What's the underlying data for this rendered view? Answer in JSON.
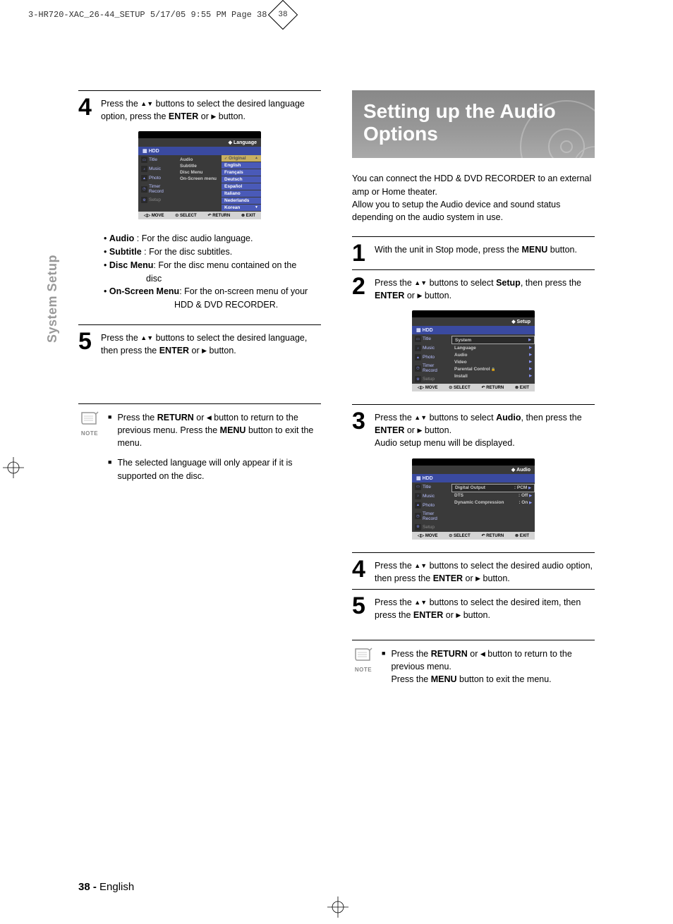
{
  "print_header": "3-HR720-XAC_26-44_SETUP  5/17/05  9:55 PM  Page 38",
  "side_tab": "System Setup",
  "left": {
    "step4": {
      "num": "4",
      "text_a": "Press the ",
      "text_b": " buttons to select the desired language option, press the ",
      "bold1": "ENTER",
      "text_c": " or ",
      "text_d": " button."
    },
    "osd1": {
      "title_tag": "Language",
      "hdd": "HDD",
      "nav": [
        "Title",
        "Music",
        "Photo",
        "Timer Record",
        "Setup"
      ],
      "mid": [
        "Audio",
        "Subtitle",
        "Disc Menu",
        "On-Screen menu"
      ],
      "list": [
        "Original",
        "English",
        "Français",
        "Deutsch",
        "Español",
        "Italiano",
        "Nederlands",
        "Korean"
      ],
      "footer": [
        "MOVE",
        "SELECT",
        "RETURN",
        "EXIT"
      ]
    },
    "defs": {
      "audio_lbl": "Audio",
      "audio_txt": " : For the disc audio language.",
      "sub_lbl": "Subtitle",
      "sub_txt": " : For the disc subtitles.",
      "disc_lbl": "Disc Menu",
      "disc_txt": ": For the disc menu contained on the",
      "disc_txt2": "disc",
      "osm_lbl": "On-Screen Menu",
      "osm_txt": ": For the on-screen menu of your",
      "osm_txt2": "HDD & DVD RECORDER."
    },
    "step5": {
      "num": "5",
      "text_a": "Press the ",
      "text_b": " buttons to select the desired language, then press the ",
      "bold1": "ENTER",
      "text_c": " or ",
      "text_d": " button."
    },
    "note_label": "NOTE",
    "note1_a": "Press the ",
    "note1_b1": "RETURN",
    "note1_c": " or ",
    "note1_d": " button to return to the previous menu. Press the ",
    "note1_b2": "MENU",
    "note1_e": " button to exit the menu.",
    "note2": "The selected language will only appear if it is supported on the disc."
  },
  "right": {
    "title": "Setting up the Audio Options",
    "intro": "You can connect the HDD & DVD RECORDER to an external amp or Home theater.\nAllow you to setup the Audio device and sound status depending on the audio system in use.",
    "step1": {
      "num": "1",
      "a": "With the unit in Stop mode, press the ",
      "b": "MENU",
      "c": " button."
    },
    "step2": {
      "num": "2",
      "a": "Press the ",
      "b": " buttons to select ",
      "c": "Setup",
      "d": ", then press the ",
      "e": "ENTER",
      "f": " or ",
      "g": " button."
    },
    "osd2": {
      "title_tag": "Setup",
      "hdd": "HDD",
      "nav": [
        "Title",
        "Music",
        "Photo",
        "Timer Record",
        "Setup"
      ],
      "list": [
        "System",
        "Language",
        "Audio",
        "Video",
        "Parental Control",
        "Install"
      ],
      "footer": [
        "MOVE",
        "SELECT",
        "RETURN",
        "EXIT"
      ]
    },
    "step3": {
      "num": "3",
      "a": "Press the ",
      "b": " buttons to select ",
      "c": "Audio",
      "d": ", then press the  ",
      "e": "ENTER",
      "f": " or ",
      "g": " button.",
      "h": "Audio setup menu will be displayed."
    },
    "osd3": {
      "title_tag": "Audio",
      "hdd": "HDD",
      "nav": [
        "Title",
        "Music",
        "Photo",
        "Timer Record",
        "Setup"
      ],
      "rows": [
        {
          "k": "Digital Output",
          "v": ": PCM"
        },
        {
          "k": "DTS",
          "v": ": Off"
        },
        {
          "k": "Dynamic Compression",
          "v": ": On"
        }
      ],
      "footer": [
        "MOVE",
        "SELECT",
        "RETURN",
        "EXIT"
      ]
    },
    "step4": {
      "num": "4",
      "a": "Press the ",
      "b": " buttons to select the desired audio option, then press the ",
      "c": "ENTER",
      "d": " or ",
      "e": " button."
    },
    "step5": {
      "num": "5",
      "a": "Press the ",
      "b": " buttons to select the desired item, then press the ",
      "c": "ENTER",
      "d": " or ",
      "e": " button."
    },
    "note_label": "NOTE",
    "rnote_a": "Press the ",
    "rnote_b": "RETURN",
    "rnote_c": " or ",
    "rnote_d": " button to return to the previous menu.",
    "rnote_e": "Press the ",
    "rnote_f": "MENU",
    "rnote_g": " button to exit the menu."
  },
  "footer": {
    "pg": "38 -",
    "lang": "English"
  }
}
